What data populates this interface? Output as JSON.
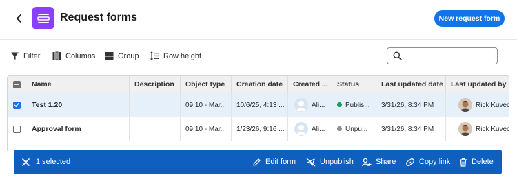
{
  "header": {
    "title": "Request forms",
    "new_button": "New request form",
    "icon_color": "#8a3ffc",
    "accent": "#1473e6"
  },
  "toolbar": {
    "filter": "Filter",
    "columns": "Columns",
    "group": "Group",
    "row_height": "Row height",
    "search_placeholder": ""
  },
  "table": {
    "columns": [
      "Name",
      "Description",
      "Object type",
      "Creation date",
      "Created ...",
      "Status",
      "Last updated date",
      "Last updated by"
    ],
    "rows": [
      {
        "selected": true,
        "name": "Test 1.20",
        "description": "",
        "object_type": "09.10 - Mar...",
        "creation_date": "10/6/25, 4:13 ...",
        "created_by": "Ali...",
        "status": "Publis...",
        "status_color": "#12a05c",
        "last_updated_date": "3/31/26, 8:34 PM",
        "last_updated_by": "Rick Kuvec"
      },
      {
        "selected": false,
        "name": "Approval form",
        "description": "",
        "object_type": "09.10 - Mar...",
        "creation_date": "1/23/26, 9:16 ...",
        "created_by": "Ali...",
        "status": "Unpu...",
        "status_color": "#8e8e8e",
        "last_updated_date": "3/31/26, 8:34 PM",
        "last_updated_by": "Rick Kuvec"
      }
    ]
  },
  "action_bar": {
    "selected_text": "1 selected",
    "edit": "Edit form",
    "unpublish": "Unpublish",
    "share": "Share",
    "copy_link": "Copy link",
    "delete": "Delete",
    "background": "#0f5fbf"
  }
}
